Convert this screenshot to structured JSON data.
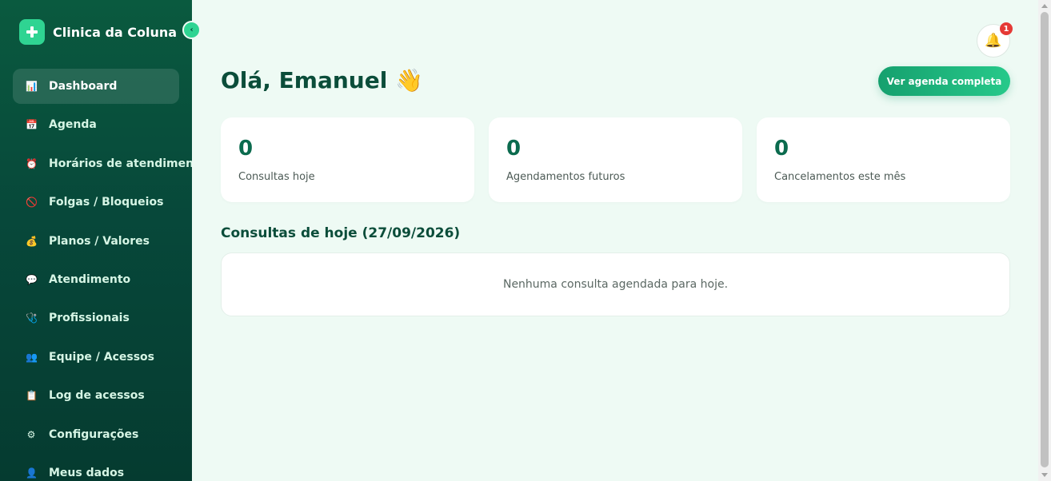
{
  "sidebar": {
    "brand": "Clinica da Coluna",
    "collapse_glyph": "‹",
    "items": [
      {
        "label": "Dashboard",
        "icon": "📊",
        "icon_name": "chart-icon",
        "active": true
      },
      {
        "label": "Agenda",
        "icon": "📅",
        "icon_name": "calendar-icon"
      },
      {
        "label": "Horários de atendimento",
        "icon": "⏰",
        "icon_name": "alarm-clock-icon"
      },
      {
        "label": "Folgas / Bloqueios",
        "icon": "🚫",
        "icon_name": "prohibited-icon"
      },
      {
        "label": "Planos / Valores",
        "icon": "💰",
        "icon_name": "money-bag-icon"
      },
      {
        "label": "Atendimento",
        "icon": "💬",
        "icon_name": "speech-bubble-icon"
      },
      {
        "label": "Profissionais",
        "icon": "🩺",
        "icon_name": "stethoscope-icon"
      },
      {
        "label": "Equipe / Acessos",
        "icon": "👥",
        "icon_name": "team-icon"
      },
      {
        "label": "Log de acessos",
        "icon": "📋",
        "icon_name": "clipboard-icon"
      },
      {
        "label": "Configurações",
        "icon": "⚙",
        "icon_name": "gear-icon"
      },
      {
        "label": "Meus dados",
        "icon": "👤",
        "icon_name": "user-icon"
      }
    ]
  },
  "header": {
    "notification_count": "1",
    "bell_glyph": "🔔"
  },
  "main": {
    "greeting": "Olá, Emanuel 👋",
    "agenda_button": "Ver agenda completa",
    "stats": [
      {
        "value": "0",
        "label": "Consultas hoje"
      },
      {
        "value": "0",
        "label": "Agendamentos futuros"
      },
      {
        "value": "0",
        "label": "Cancelamentos este mês"
      }
    ],
    "section_title": "Consultas de hoje (27/09/2026)",
    "empty_message": "Nenhuma consulta agendada para hoje."
  },
  "colors": {
    "sidebar_bg": "#07483a",
    "accent": "#2fd492",
    "page_bg": "#eefaf4",
    "heading": "#0b4d3a"
  }
}
